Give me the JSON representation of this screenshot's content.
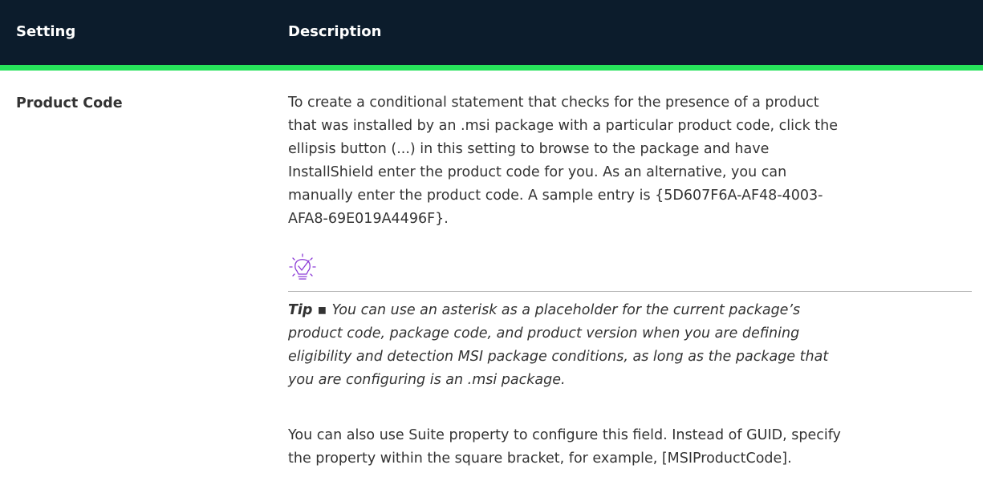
{
  "table": {
    "headers": {
      "setting": "Setting",
      "description": "Description"
    },
    "row": {
      "setting": "Product Code",
      "paragraph1_lines": [
        "To create a conditional statement that checks for the presence of a product",
        "that was installed by an .msi package with a particular product code, click the",
        "ellipsis button (...) in this setting to browse to the package and have",
        "InstallShield enter the product code for you. As an alternative, you can",
        "manually enter the product code. A sample entry is {5D607F6A-AF48-4003-",
        "AFA8-69E019A4496F}."
      ],
      "tip": {
        "icon": "lightbulb-check-icon",
        "label": "Tip",
        "separator": " ▪ ",
        "lines": [
          "You can use an asterisk as a placeholder for the current package’s",
          "product code, package code, and product version when you are defining",
          "eligibility and detection MSI package conditions, as long as the package that",
          "you are configuring is an .msi package."
        ]
      },
      "paragraph2_lines": [
        "You can also use Suite property to configure this field. Instead of GUID, specify",
        "the property within the square bracket, for example, [MSIProductCode]."
      ]
    }
  },
  "colors": {
    "header_bg": "#0c1c2c",
    "header_accent": "#27e35b",
    "text": "#333333",
    "tip_icon": "#8c3bd6"
  }
}
